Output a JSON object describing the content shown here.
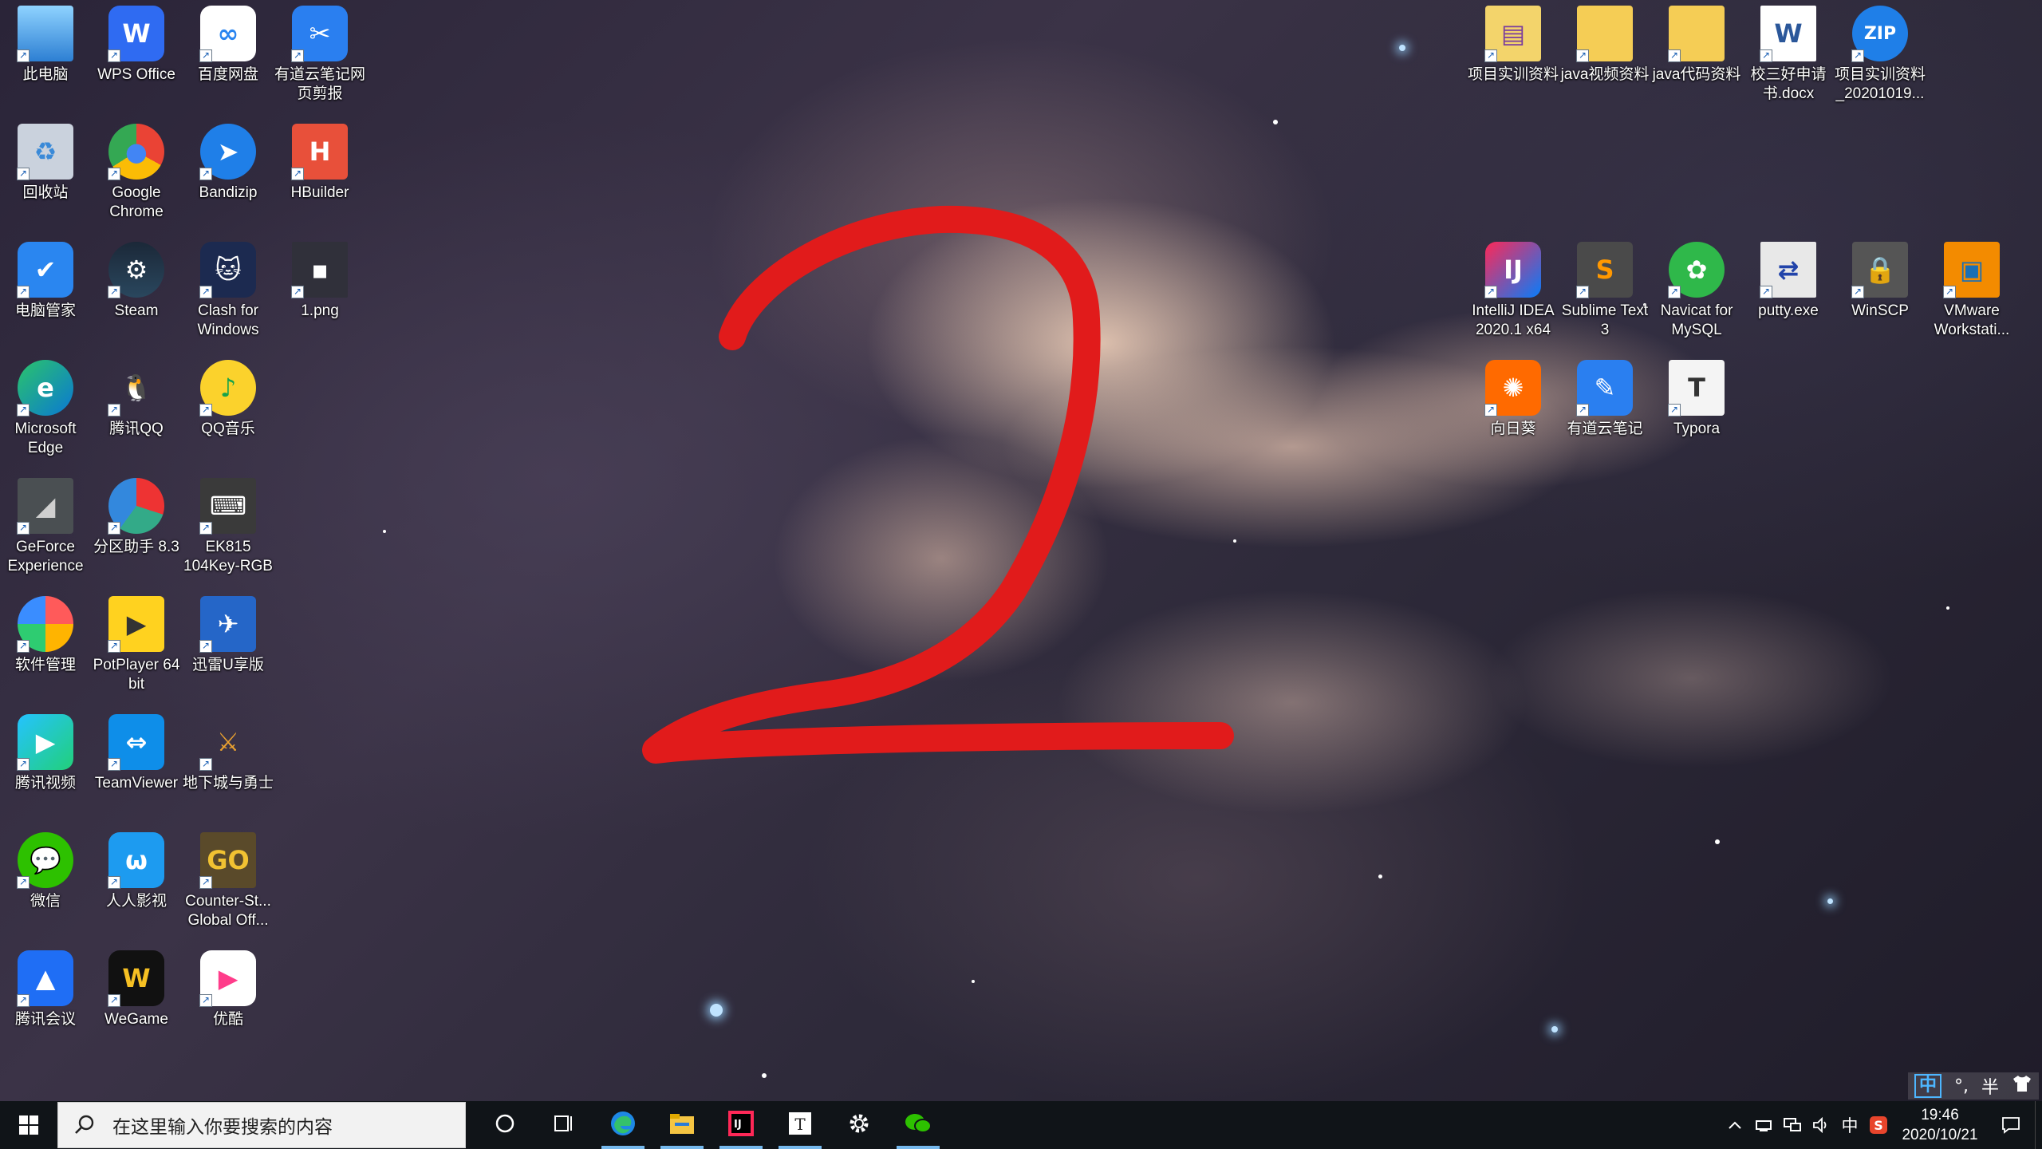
{
  "desktop": {
    "annotation_text": "2",
    "icons_left": [
      {
        "label": "此电脑",
        "icon": "this-pc-icon"
      },
      {
        "label": "WPS Office",
        "icon": "wps-icon"
      },
      {
        "label": "百度网盘",
        "icon": "baidu-netdisk-icon"
      },
      {
        "label": "有道云笔记网页剪报",
        "icon": "youdao-clipper-icon"
      },
      {
        "label": "回收站",
        "icon": "recycle-bin-icon"
      },
      {
        "label": "Google Chrome",
        "icon": "chrome-icon"
      },
      {
        "label": "Bandizip",
        "icon": "bandizip-icon"
      },
      {
        "label": "HBuilder",
        "icon": "hbuilder-icon"
      },
      {
        "label": "电脑管家",
        "icon": "pc-manager-icon"
      },
      {
        "label": "Steam",
        "icon": "steam-icon"
      },
      {
        "label": "Clash for Windows",
        "icon": "clash-icon"
      },
      {
        "label": "1.png",
        "icon": "image-file-icon"
      },
      {
        "label": "Microsoft Edge",
        "icon": "edge-icon"
      },
      {
        "label": "腾讯QQ",
        "icon": "qq-icon"
      },
      {
        "label": "QQ音乐",
        "icon": "qq-music-icon"
      },
      {
        "label": "GeForce Experience",
        "icon": "geforce-icon"
      },
      {
        "label": "分区助手 8.3",
        "icon": "partition-assistant-icon"
      },
      {
        "label": "EK815 104Key-RGB",
        "icon": "keyboard-icon"
      },
      {
        "label": "软件管理",
        "icon": "software-manager-icon"
      },
      {
        "label": "PotPlayer 64 bit",
        "icon": "potplayer-icon"
      },
      {
        "label": "迅雷U享版",
        "icon": "xunlei-icon"
      },
      {
        "label": "腾讯视频",
        "icon": "tencent-video-icon"
      },
      {
        "label": "TeamViewer",
        "icon": "teamviewer-icon"
      },
      {
        "label": "地下城与勇士",
        "icon": "dnf-icon"
      },
      {
        "label": "微信",
        "icon": "wechat-icon"
      },
      {
        "label": "人人影视",
        "icon": "rrys-icon"
      },
      {
        "label": "Counter-St... Global Off...",
        "icon": "csgo-icon"
      },
      {
        "label": "腾讯会议",
        "icon": "tencent-meeting-icon"
      },
      {
        "label": "WeGame",
        "icon": "wegame-icon"
      },
      {
        "label": "优酷",
        "icon": "youku-icon"
      }
    ],
    "icons_right": [
      {
        "label": "项目实训资料",
        "icon": "winrar-archive-icon"
      },
      {
        "label": "java视频资料",
        "icon": "folder-icon"
      },
      {
        "label": "java代码资料",
        "icon": "folder-icon"
      },
      {
        "label": "校三好申请书.docx",
        "icon": "word-doc-icon"
      },
      {
        "label": "项目实训资料_20201019...",
        "icon": "zip-archive-icon"
      },
      {
        "label": "IntelliJ IDEA 2020.1 x64",
        "icon": "intellij-icon"
      },
      {
        "label": "Sublime Text 3",
        "icon": "sublime-icon"
      },
      {
        "label": "Navicat for MySQL",
        "icon": "navicat-icon"
      },
      {
        "label": "putty.exe",
        "icon": "putty-icon"
      },
      {
        "label": "WinSCP",
        "icon": "winscp-icon"
      },
      {
        "label": "VMware Workstati...",
        "icon": "vmware-icon"
      },
      {
        "label": "向日葵",
        "icon": "sunlogin-icon"
      },
      {
        "label": "有道云笔记",
        "icon": "youdao-note-icon"
      },
      {
        "label": "Typora",
        "icon": "typora-icon"
      }
    ]
  },
  "ime_bar": {
    "mode": "中",
    "punct": "°,",
    "width": "半",
    "skin_icon": "shirt-icon"
  },
  "taskbar": {
    "search_placeholder": "在这里输入你要搜索的内容",
    "apps": [
      {
        "name": "cortana-icon",
        "active": false
      },
      {
        "name": "task-view-icon",
        "active": false
      },
      {
        "name": "edge-icon",
        "active": true
      },
      {
        "name": "file-explorer-icon",
        "active": true
      },
      {
        "name": "intellij-icon",
        "active": true
      },
      {
        "name": "typora-icon",
        "active": true
      },
      {
        "name": "settings-icon",
        "active": false
      },
      {
        "name": "wechat-icon",
        "active": true
      }
    ],
    "tray": {
      "ime": "中",
      "time": "19:46",
      "date": "2020/10/21"
    }
  },
  "colors": {
    "annotation": "#e11b1b",
    "taskbar": "#101418",
    "active_indicator": "#76b9ed"
  }
}
